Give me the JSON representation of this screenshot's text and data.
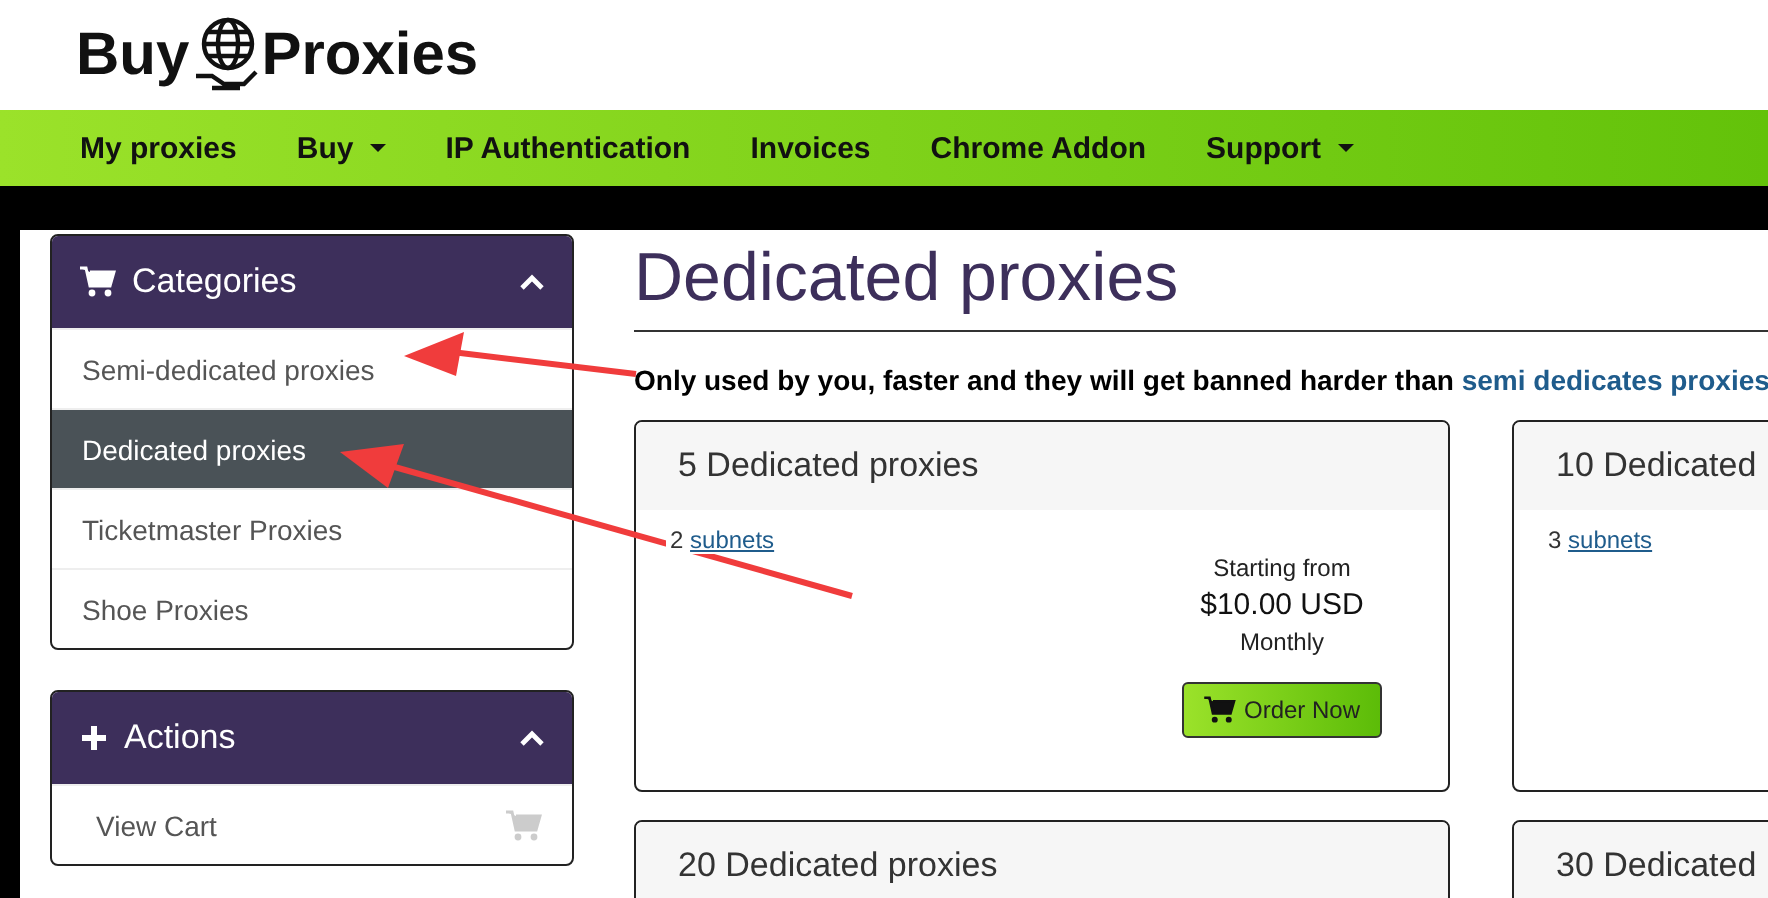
{
  "logo": {
    "left": "Buy",
    "right": "Proxies"
  },
  "nav": [
    {
      "label": "My proxies",
      "dropdown": false
    },
    {
      "label": "Buy",
      "dropdown": true
    },
    {
      "label": "IP Authentication",
      "dropdown": false
    },
    {
      "label": "Invoices",
      "dropdown": false
    },
    {
      "label": "Chrome Addon",
      "dropdown": false
    },
    {
      "label": "Support",
      "dropdown": true
    }
  ],
  "sidebar": [
    {
      "title": "Categories",
      "expanded": true,
      "items": [
        {
          "label": "Semi-dedicated proxies",
          "selected": false
        },
        {
          "label": "Dedicated proxies",
          "selected": true
        },
        {
          "label": "Ticketmaster Proxies",
          "selected": false
        },
        {
          "label": "Shoe Proxies",
          "selected": false
        }
      ]
    },
    {
      "title": "Actions",
      "expanded": true,
      "items": [
        {
          "label": "View Cart",
          "selected": false
        }
      ]
    }
  ],
  "page": {
    "title": "Dedicated proxies",
    "description": "Only used by you, faster and they will get banned harder than",
    "description_link": "semi dedicates proxies"
  },
  "cards": [
    {
      "title": "5 Dedicated proxies",
      "subnets_count": "2",
      "subnets_link": "subnets",
      "price_label": "Starting from",
      "price": "$10.00 USD",
      "period": "Monthly",
      "button": "Order Now"
    },
    {
      "title": "10 Dedicated",
      "subnets_count": "3",
      "subnets_link": "subnets"
    },
    {
      "title": "20 Dedicated proxies"
    },
    {
      "title": "30 Dedicated"
    }
  ]
}
